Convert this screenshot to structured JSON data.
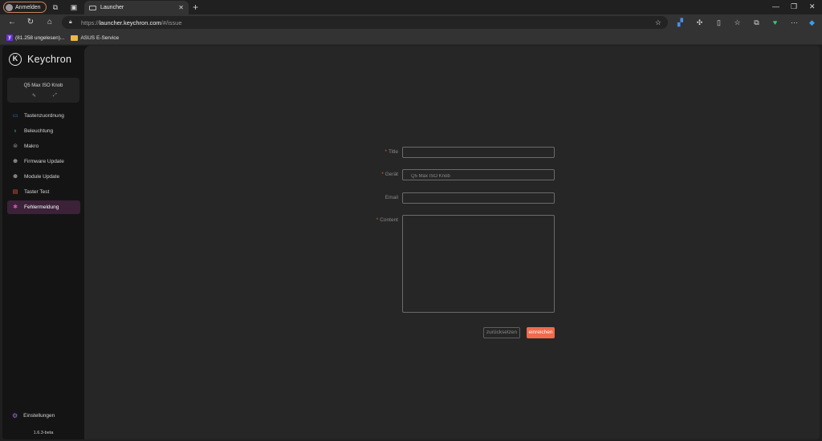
{
  "browser": {
    "profile_label": "Anmelden",
    "tab_title": "Launcher",
    "url_scheme": "https://",
    "url_host": "launcher.keychron.com",
    "url_path": "/#/issue",
    "bookmarks": [
      {
        "label": "(81.258 ungelesen)...",
        "icon": "yahoo-mail-icon"
      },
      {
        "label": "ASUS E-Service",
        "icon": "folder-icon"
      }
    ]
  },
  "app": {
    "brand": "Keychron",
    "device_name": "Q5 Max ISO Knob",
    "menu": [
      {
        "label": "Tastenzuordnung",
        "icon": "keyboard-icon",
        "color": "#3a7bd5"
      },
      {
        "label": "Beleuchtung",
        "icon": "bulb-icon",
        "color": "#3fc8a0"
      },
      {
        "label": "Makro",
        "icon": "macro-icon",
        "color": "#9a9a9a"
      },
      {
        "label": "Firmware Update",
        "icon": "plus-circle-icon",
        "color": "#e0e0e0"
      },
      {
        "label": "Module Update",
        "icon": "plus-circle-icon",
        "color": "#e0e0e0"
      },
      {
        "label": "Taster Test",
        "icon": "calendar-icon",
        "color": "#e2583b"
      },
      {
        "label": "Fehlermeldung",
        "icon": "bug-icon",
        "color": "#d05ab8"
      }
    ],
    "active_menu": "Fehlermeldung",
    "settings_label": "Einstellungen",
    "version": "1.6.3-beta"
  },
  "form": {
    "title_label": "Title",
    "title_value": "",
    "device_label": "Gerät",
    "device_value": "Q5 Max ISO Knob",
    "email_label": "Email",
    "email_value": "",
    "content_label": "Content",
    "content_value": "",
    "reset_label": "zurücksetzen",
    "submit_label": "einreichen",
    "accent_color": "#f06a4b"
  }
}
